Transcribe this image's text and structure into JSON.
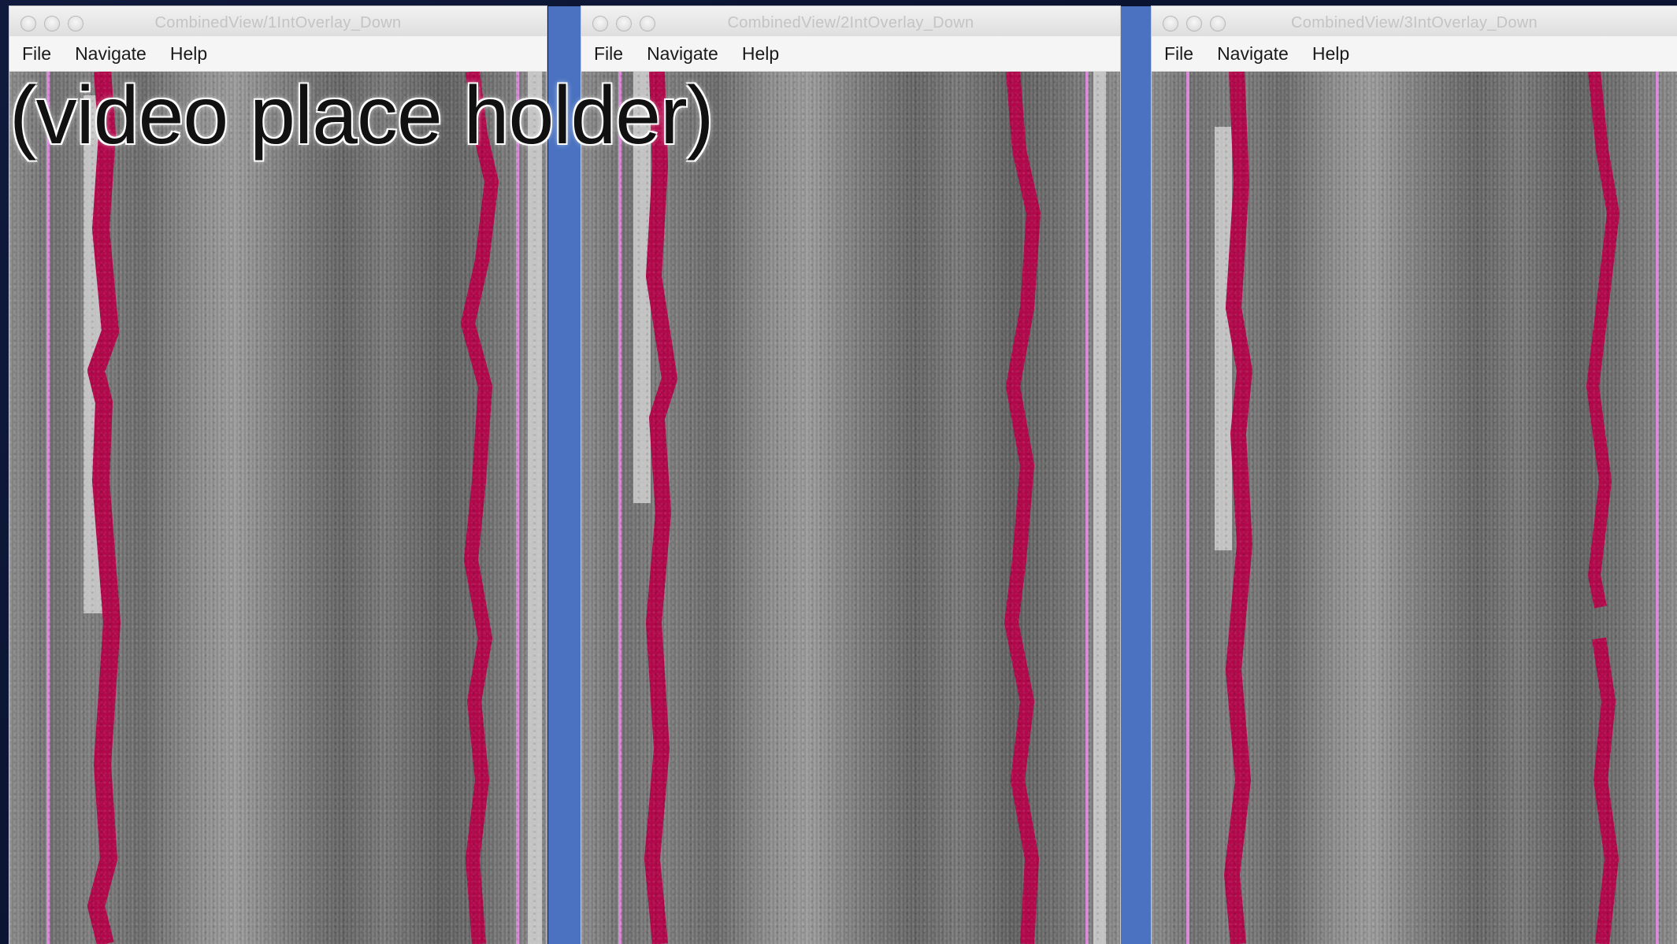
{
  "placeholder_text": "(video place holder)",
  "overlay_colors": {
    "edge_detection": "#b0084a",
    "lane_guide": "#d889d8",
    "window_gap": "#4a72c0"
  },
  "windows": [
    {
      "title": "CombinedView/1IntOverlay_Down",
      "menu": [
        "File",
        "Navigate",
        "Help"
      ]
    },
    {
      "title": "CombinedView/2IntOverlay_Down",
      "menu": [
        "File",
        "Navigate",
        "Help"
      ]
    },
    {
      "title": "CombinedView/3IntOverlay_Down",
      "menu": [
        "File",
        "Navigate",
        "Help"
      ]
    }
  ]
}
